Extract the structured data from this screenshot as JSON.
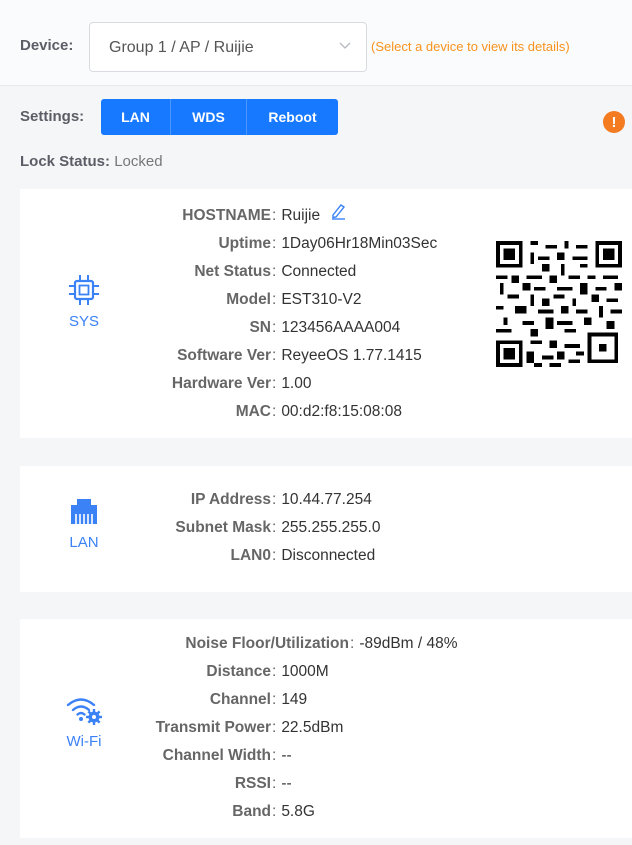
{
  "device": {
    "label": "Device:",
    "selected": "Group 1 / AP / Ruijie",
    "hint": "(Select a device to view its details)"
  },
  "settings": {
    "label": "Settings:",
    "buttons": [
      "LAN",
      "WDS",
      "Reboot"
    ]
  },
  "warning_icon": "!",
  "lock": {
    "label": "Lock Status:",
    "value": "Locked"
  },
  "sys": {
    "title": "SYS",
    "icon": "chip-icon",
    "rows": [
      {
        "k": "HOSTNAME",
        "v": "Ruijie"
      },
      {
        "k": "Uptime",
        "v": "1Day06Hr18Min03Sec"
      },
      {
        "k": "Net Status",
        "v": "Connected"
      },
      {
        "k": "Model",
        "v": "EST310-V2"
      },
      {
        "k": "SN",
        "v": "123456AAAA004"
      },
      {
        "k": "Software Ver",
        "v": "ReyeeOS 1.77.1415"
      },
      {
        "k": "Hardware Ver",
        "v": "1.00"
      },
      {
        "k": "MAC",
        "v": "00:d2:f8:15:08:08"
      }
    ]
  },
  "lan": {
    "title": "LAN",
    "icon": "ethernet-port-icon",
    "rows": [
      {
        "k": "IP Address",
        "v": "10.44.77.254"
      },
      {
        "k": "Subnet Mask",
        "v": "255.255.255.0"
      },
      {
        "k": "LAN0",
        "v": "Disconnected"
      }
    ]
  },
  "wifi": {
    "title": "Wi-Fi",
    "icon": "wifi-settings-icon",
    "rows": [
      {
        "k": "Noise Floor/Utilization",
        "v": "-89dBm / 48%"
      },
      {
        "k": "Distance",
        "v": "1000M"
      },
      {
        "k": "Channel",
        "v": "149"
      },
      {
        "k": "Transmit Power",
        "v": "22.5dBm"
      },
      {
        "k": "Channel Width",
        "v": "--"
      },
      {
        "k": "RSSI",
        "v": "--"
      },
      {
        "k": "Band",
        "v": "5.8G"
      }
    ]
  },
  "colors": {
    "accent": "#1779ff",
    "hint": "#f7931e",
    "warning": "#f47b20",
    "icon": "#3b82f6"
  }
}
